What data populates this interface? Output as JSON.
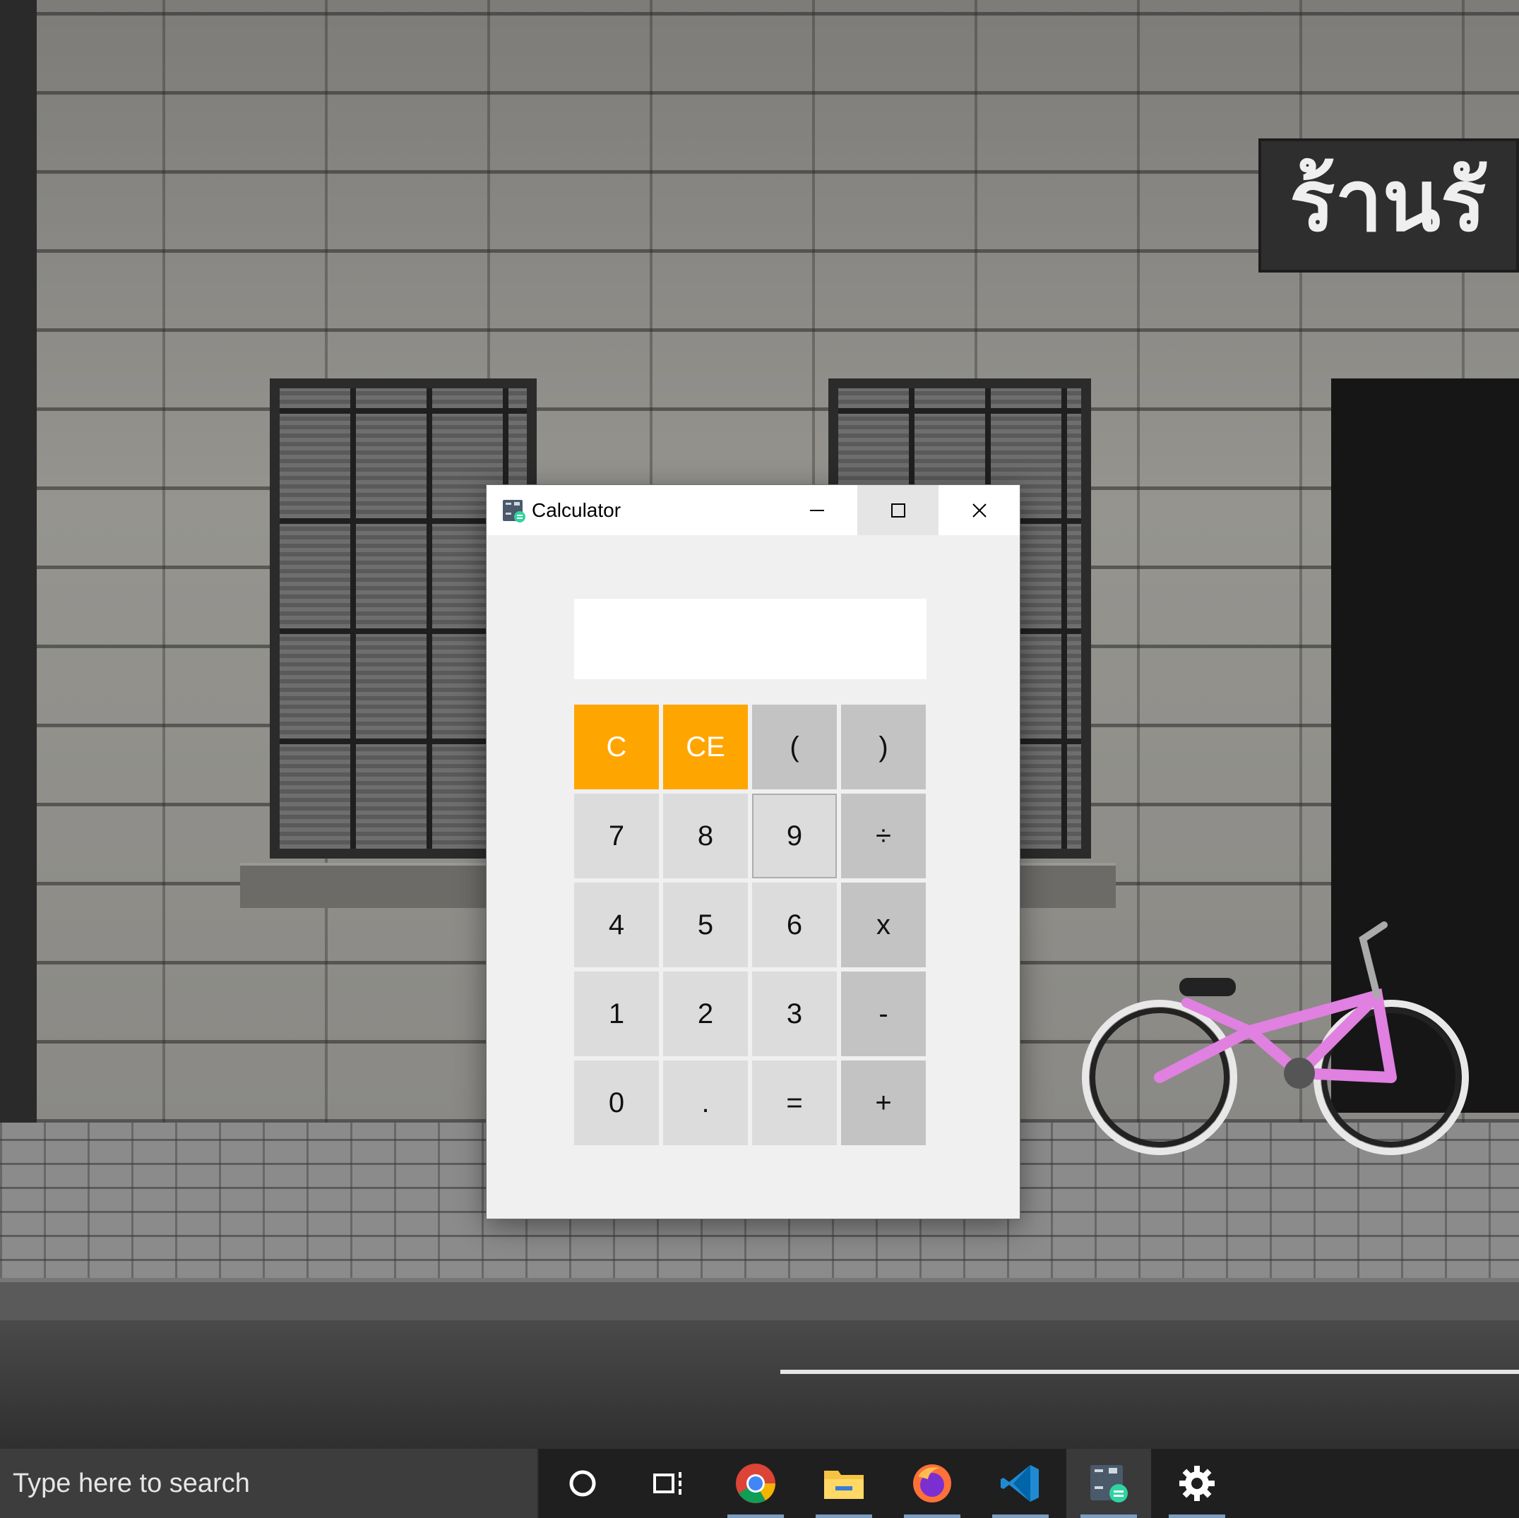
{
  "window": {
    "title": "Calculator",
    "minimize_icon": "minimize-icon",
    "maximize_icon": "maximize-icon",
    "close_icon": "close-icon"
  },
  "display": {
    "value": ""
  },
  "keys": {
    "clear": "C",
    "clear_entry": "CE",
    "paren_open": "(",
    "paren_close": ")",
    "seven": "7",
    "eight": "8",
    "nine": "9",
    "divide": "÷",
    "four": "4",
    "five": "5",
    "six": "6",
    "multiply": "x",
    "one": "1",
    "two": "2",
    "three": "3",
    "subtract": "-",
    "zero": "0",
    "decimal": ".",
    "equals": "=",
    "add": "+"
  },
  "colors": {
    "clear_keys": "#ffa500",
    "digit_keys": "#dcdcdc",
    "operator_keys": "#c3c3c3",
    "window_bg": "#f0f0f0"
  },
  "wallpaper": {
    "sign_text": "ร้านรั"
  },
  "taskbar": {
    "search_placeholder": "Type here to search",
    "items": [
      "cortana-icon",
      "task-view-icon",
      "chrome-icon",
      "file-explorer-icon",
      "firefox-icon",
      "vscode-icon",
      "calculator-icon",
      "settings-icon"
    ],
    "active_item": "calculator-icon"
  }
}
